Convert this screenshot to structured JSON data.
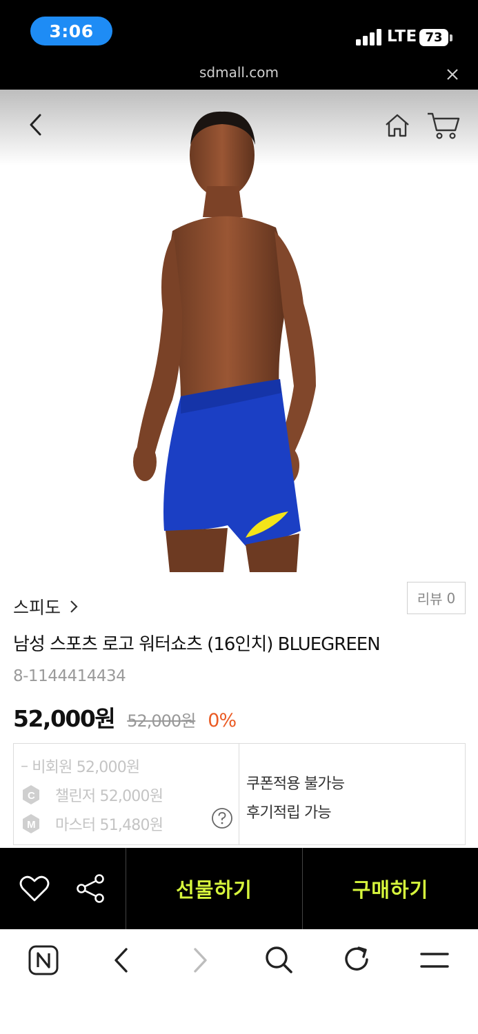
{
  "status_bar": {
    "time": "3:06",
    "network": "LTE",
    "battery": "73"
  },
  "url_bar": {
    "domain": "sdmall.com"
  },
  "icons": {
    "back": "chevron-left-icon",
    "home": "home-icon",
    "cart": "cart-icon",
    "heart": "heart-icon",
    "share": "share-icon",
    "help": "question-circle-icon"
  },
  "product": {
    "brand": "스피도",
    "review_label": "리뷰",
    "review_count": "0",
    "name": "남성 스포츠 로고 워터쇼츠 (16인치) BLUEGREEN",
    "code": "8-1144414434",
    "price": "52,000원",
    "original_price": "52,000원",
    "discount": "0%"
  },
  "benefits": {
    "tiers": [
      {
        "badge": "–",
        "label": "비회원 52,000원"
      },
      {
        "badge": "C",
        "label": "챌린저 52,000원"
      },
      {
        "badge": "M",
        "label": "마스터 51,480원"
      }
    ],
    "notes": [
      "쿠폰적용 불가능",
      "후기적립 가능"
    ]
  },
  "actions": {
    "gift_label": "선물하기",
    "buy_label": "구매하기"
  },
  "colors": {
    "accent": "#d6f53c",
    "discount": "#ea5b24",
    "time_pill": "#1e8cf5",
    "shorts": "#1b3fc4",
    "logo": "#f4e419"
  }
}
